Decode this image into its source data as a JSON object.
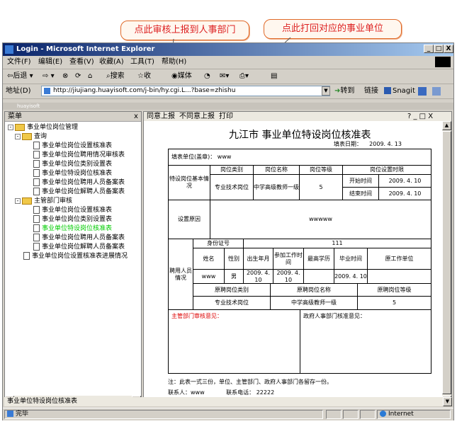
{
  "callouts": {
    "report_tip": "点此审核上报到人事部门",
    "return_tip": "点此打回对应的事业单位"
  },
  "window": {
    "title": "Login - Microsoft Internet Explorer",
    "controls": {
      "minimize": "_",
      "maximize": "□",
      "close": "X"
    }
  },
  "menu": [
    "文件(F)",
    "编辑(E)",
    "查看(V)",
    "收藏(A)",
    "工具(T)",
    "帮助(H)"
  ],
  "toolbar": {
    "back": "后退",
    "forward": "",
    "search": "搜索",
    "favorites": "收",
    "media": "媒体"
  },
  "address": {
    "label": "地址(D)",
    "url": "http://jiujiang.huayisoft.com/j-bin/hy.cgi.L...?base=zhishu",
    "go": "转到",
    "links": "链接",
    "snagit": "Snagit"
  },
  "frame": {
    "title": "huayisoft"
  },
  "left_pane": {
    "title": "菜单",
    "close": "x",
    "root": "事业单位岗位管理",
    "group1": "查询",
    "group1_items": [
      "事业单位岗位设置核准表",
      "事业单位岗位聘用情况审核表",
      "事业单位岗位类别设置表",
      "事业单位特设岗位核准表",
      "事业单位岗位聘用人员备案表",
      "事业单位岗位解聘人员备案表"
    ],
    "group2": "主管部门审核",
    "group2_items": [
      "事业单位岗位设置核准表",
      "事业单位岗位类别设置表",
      "事业单位特设岗位核准表",
      "事业单位岗位聘用人员备案表",
      "事业单位岗位解聘人员备案表"
    ],
    "last_item": "事业单位岗位设置核准表进展情况"
  },
  "right_toolbar": {
    "approve": "同意上报",
    "reject": "不同意上报",
    "print": "打印",
    "controls": "? _ □ X"
  },
  "form": {
    "title": "九江市 事业单位特设岗位核准表",
    "fill_date_label": "填表日期：",
    "fill_date": "2009. 4. 13",
    "unit_label": "填表单位(盖章)：",
    "unit_value": "www",
    "basic_label": "特设岗位基本情况",
    "col_category": "岗位类别",
    "col_name": "岗位名称",
    "col_level": "岗位等级",
    "col_period": "岗位设置时限",
    "category": "专业技术岗位",
    "post_name": "中学高级教师一级",
    "level": "5",
    "start_label": "开始时间",
    "start": "2009. 4. 10",
    "end_label": "结束时间",
    "end": "2009. 4. 10",
    "reason_label": "设置原因",
    "reason": "wwwww",
    "idno_label": "身份证号",
    "idno": "111",
    "name_label": "姓名",
    "gender_label": "性别",
    "birth_label": "出生年月",
    "work_label": "参加工作时间",
    "edu_label": "最高学历",
    "grad_label": "毕业时间",
    "orig_unit_label": "原工作单位",
    "hired_label": "聘用人员情况",
    "name": "www",
    "gender": "男",
    "birth": "2009. 4. 10",
    "work": "2009. 4. 10",
    "grad": "2009. 4. 10",
    "orig_cat_label": "原聘岗位类别",
    "orig_name_label": "原聘岗位名称",
    "orig_level_label": "原聘岗位等级",
    "orig_cat": "专业技术岗位",
    "orig_name": "中学高级教师一级",
    "orig_level": "5",
    "dept_opinion": "主管部门审核意见：",
    "hr_opinion": "政府人事部门核准意见：",
    "note": "注：此表一式三份，单位、主管部门、政府人事部门各留存一份。",
    "contact_label": "联系人：",
    "contact": "www",
    "phone_label": "联系电话：",
    "phone": "22222"
  },
  "status_left": "事业单位特设岗位核准表",
  "status": {
    "text": "完毕",
    "zone": "Internet"
  },
  "colors": {
    "title_start": "#0a246a",
    "title_end": "#a6caf0",
    "callout_text": "#dd2222",
    "highlight_item": "#00cc00",
    "opinion_red": "#dd0000"
  }
}
